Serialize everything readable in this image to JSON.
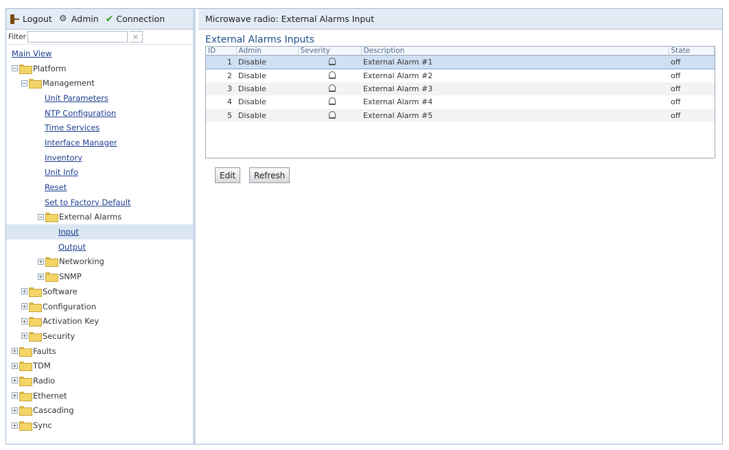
{
  "topbar": {
    "logout_label": "Logout",
    "admin_label": "Admin",
    "connection_label": "Connection"
  },
  "filter": {
    "label": "Filter",
    "value": "",
    "clear_label": "×"
  },
  "tree": {
    "main_view": "Main View",
    "platform": "Platform",
    "management": "Management",
    "unit_parameters": "Unit Parameters",
    "ntp_configuration": "NTP Configuration",
    "time_services": "Time Services",
    "interface_manager": "Interface Manager",
    "inventory": "Inventory",
    "unit_info": "Unit Info",
    "reset": "Reset",
    "set_factory_default": "Set to Factory Default",
    "external_alarms": "External Alarms",
    "input": "Input",
    "output": "Output",
    "networking": "Networking",
    "snmp": "SNMP",
    "software": "Software",
    "configuration": "Configuration",
    "activation_key": "Activation Key",
    "security": "Security",
    "faults": "Faults",
    "tdm": "TDM",
    "radio": "Radio",
    "ethernet": "Ethernet",
    "cascading": "Cascading",
    "sync": "Sync"
  },
  "main": {
    "header": "Microwave radio: External Alarms Input",
    "section_title": "External Alarms Inputs",
    "columns": {
      "id": "ID",
      "admin": "Admin",
      "severity": "Severity",
      "description": "Description",
      "state": "State"
    },
    "rows": [
      {
        "id": "1",
        "admin": "Disable",
        "severity": "bell-icon",
        "description": "External Alarm #1",
        "state": "off"
      },
      {
        "id": "2",
        "admin": "Disable",
        "severity": "bell-icon",
        "description": "External Alarm #2",
        "state": "off"
      },
      {
        "id": "3",
        "admin": "Disable",
        "severity": "bell-icon",
        "description": "External Alarm #3",
        "state": "off"
      },
      {
        "id": "4",
        "admin": "Disable",
        "severity": "bell-icon",
        "description": "External Alarm #4",
        "state": "off"
      },
      {
        "id": "5",
        "admin": "Disable",
        "severity": "bell-icon",
        "description": "External Alarm #5",
        "state": "off"
      }
    ],
    "edit_label": "Edit",
    "refresh_label": "Refresh"
  },
  "colors": {
    "header_bg": "#e3ebf5",
    "link": "#1a3d8f",
    "selected_row": "#cfe0f3",
    "section_title": "#1f4e8a"
  }
}
